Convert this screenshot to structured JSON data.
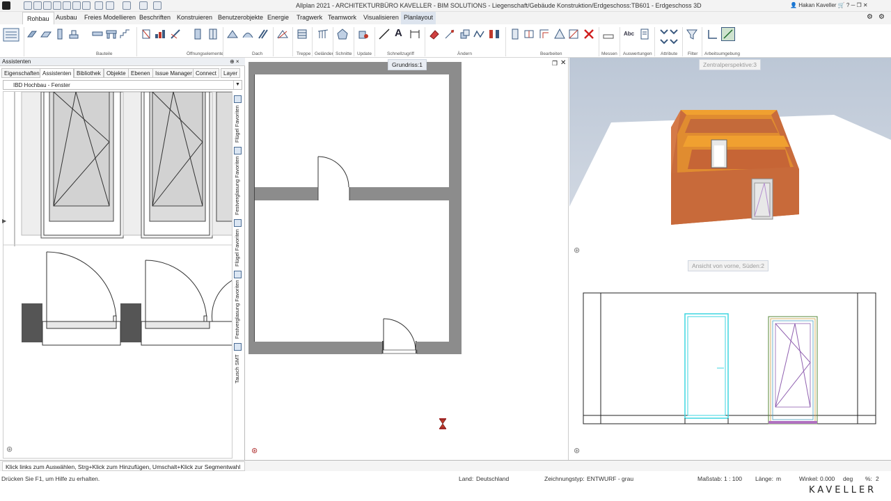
{
  "title": "Allplan 2021 - ARCHITEKTURBÜRO KAVELLER - BIM SOLUTIONS - Liegenschaft/Gebäude Konstruktion/Erdgeschoss:TB601 - Erdgeschoss 3D",
  "user": "Hakan Kaveller",
  "menu": [
    "Rohbau",
    "Ausbau",
    "Freies Modellieren",
    "Beschriften",
    "Konstruieren",
    "Benutzerobjekte",
    "Energie",
    "Tragwerk",
    "Teamwork",
    "Visualisieren",
    "Planlayout"
  ],
  "ribbon_groups": [
    "Bauteile",
    "Öffnungselemente",
    "Dach",
    "Treppe",
    "Geländer",
    "Schnitte",
    "Update",
    "Schnellzugriff",
    "Ändern",
    "Bearbeiten",
    "Messen",
    "Auswertungen",
    "Attribute",
    "Filter",
    "Arbeitsumgebung"
  ],
  "ribbon_text_icons": {
    "text_a": "A",
    "abc": "Abc"
  },
  "assistants": {
    "header": "Assistenten",
    "pin": "⊕ ×",
    "tabs": [
      "Eigenschaften",
      "Assistenten",
      "Bibliothek",
      "Objekte",
      "Ebenen",
      "Issue Manager",
      "Connect",
      "Layer"
    ],
    "selected": "IBD Hochbau - Fenster",
    "side_tabs": [
      "Flügel Favoriten",
      "Festverglasung Favoriten",
      "Flügel Favoriten",
      "Festverglasung Favoriten",
      "Tausch SMT"
    ]
  },
  "views": {
    "grundriss": "Grundriss:1",
    "perspective": "Zentralperspektive:3",
    "ansicht": "Ansicht von vorne, Süden:2"
  },
  "status": {
    "hint": "Klick links zum Auswählen, Strg+Klick zum Hinzufügen, Umschalt+Klick zur Segmentwahl",
    "help": "Drücken Sie F1, um Hilfe zu erhalten.",
    "land_label": "Land:",
    "land_value": "Deutschland",
    "zt_label": "Zeichnungstyp:",
    "zt_value": "ENTWURF - grau",
    "ms_label": "Maßstab:",
    "ms_value": "1 : 100",
    "laenge_label": "Länge:",
    "laenge_value": "m",
    "winkel_label": "Winkel:",
    "winkel_value": "0.000",
    "winkel_unit": "deg",
    "pct_label": "%:",
    "pct_value": "2"
  },
  "brand": "KAVELLER",
  "colors": {
    "accent": "#2b579a",
    "wall": "#8c8c8c",
    "brick": "#c86a3a",
    "cyan": "#3cd6e0",
    "door_mark": "#c0392b"
  }
}
